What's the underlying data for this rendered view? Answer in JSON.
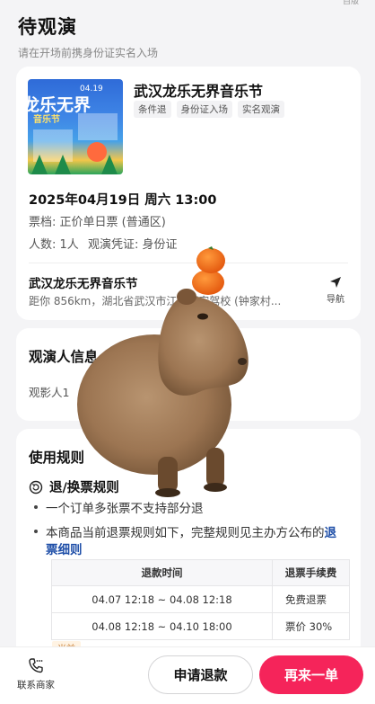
{
  "header": {
    "title": "待观演",
    "subtitle": "请在开场前携身份证实名入场",
    "corner_clip": "自版"
  },
  "ticket": {
    "poster": {
      "title_text": "龙乐无界",
      "subtitle_text": "音乐节",
      "date_text": "04.19"
    },
    "event_name": "武汉龙乐无界音乐节",
    "tags": [
      "条件退",
      "身份证入场",
      "实名观演"
    ],
    "show_time": "2025年04月19日 周六 13:00",
    "tier": "票档: 正价单日票 (普通区)",
    "count": "人数: 1人",
    "proof": "观演凭证: 身份证",
    "venue_name": "武汉龙乐无界音乐节",
    "venue_address": "距你 856km，湖北省武汉市江夏区安驾校 (钟家村...",
    "nav_label": "导航"
  },
  "viewer": {
    "title": "观演人信息",
    "name_row": "观影人1"
  },
  "rules": {
    "title": "使用规则",
    "refund_heading": "退/换票规则",
    "item1": "一个订单多张票不支持部分退",
    "item2_prefix": "本商品当前退票规则如下，完整规则见主办方公布的",
    "item2_link": "退票细则",
    "table": {
      "headers": [
        "退款时间",
        "退票手续费"
      ],
      "rows": [
        {
          "time": "04.07 12:18 ~ 04.08 12:18",
          "fee": "免费退票"
        },
        {
          "time": "04.08 12:18 ~ 04.10 18:00",
          "fee": "票价 30%"
        }
      ]
    },
    "peek_tag": "当前"
  },
  "bottom_bar": {
    "contact_label": "联系商家",
    "refund_button": "申请退款",
    "again_button": "再来一单"
  },
  "colors": {
    "accent": "#f5245a",
    "link": "#1f4fa8",
    "background": "#f4f4f6"
  },
  "icons": {
    "nav": "navigation-arrow-icon",
    "contact": "phone-chat-icon",
    "refund_rule": "refresh-circle-icon"
  }
}
